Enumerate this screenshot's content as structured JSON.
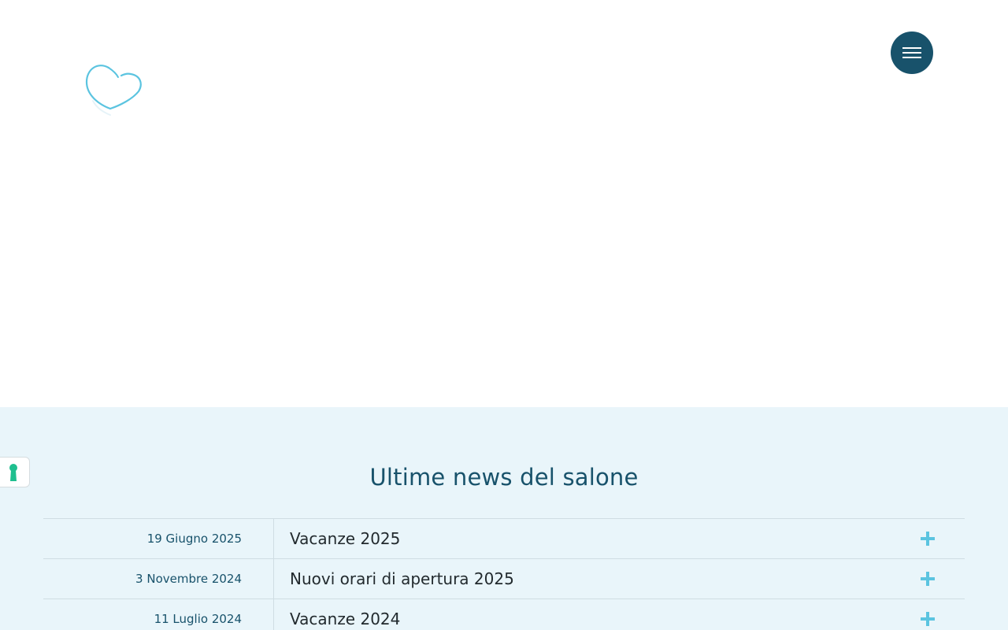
{
  "header": {
    "logo_icon": "heart-outline-logo",
    "menu_icon": "hamburger-icon"
  },
  "news": {
    "title": "Ultime news del salone",
    "items": [
      {
        "date": "19 Giugno 2025",
        "title": "Vacanze 2025",
        "icon": "plus-icon"
      },
      {
        "date": "3 Novembre 2024",
        "title": "Nuovi orari di apertura 2025",
        "icon": "plus-icon"
      },
      {
        "date": "11 Luglio 2024",
        "title": "Vacanze 2024",
        "icon": "plus-icon"
      }
    ]
  },
  "privacy": {
    "icon": "keyhole-icon"
  },
  "colors": {
    "brand": "#18526b",
    "accent": "#5bc4e0",
    "news_background": "#e9f5fa",
    "privacy_icon": "#1fbf8f"
  }
}
